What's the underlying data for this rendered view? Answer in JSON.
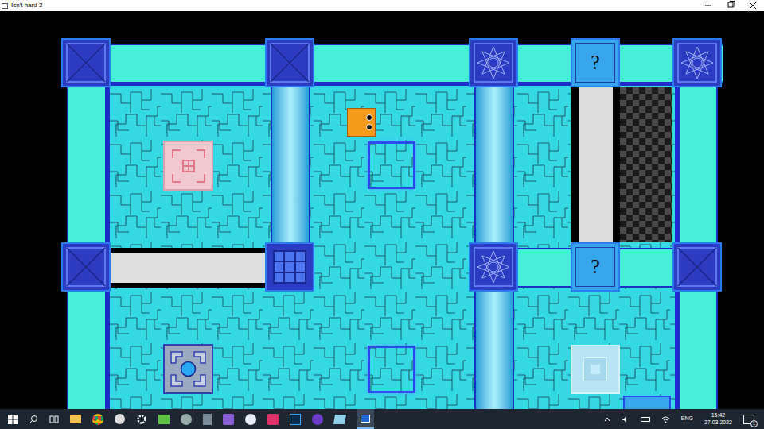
{
  "window": {
    "title": "Isn't hard 2"
  },
  "board": {
    "question_blocks": [
      {
        "label": "?"
      },
      {
        "label": "?"
      }
    ]
  },
  "taskbar": {
    "language": "ENG",
    "time": "15:42",
    "date": "27.03.2022",
    "notifications": "1"
  }
}
